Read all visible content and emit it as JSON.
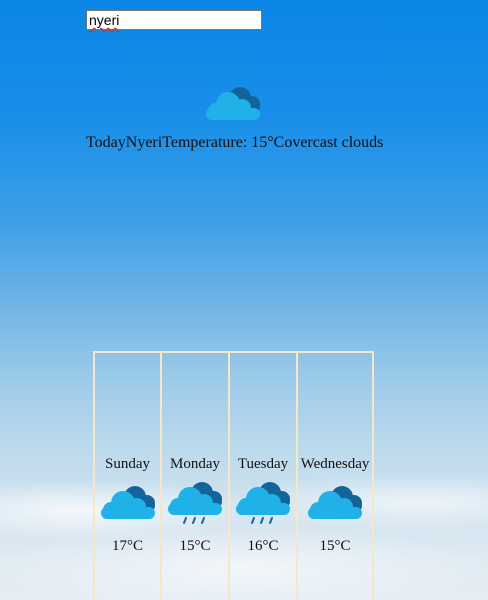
{
  "search": {
    "value": "nyeri"
  },
  "today": {
    "label": "Today",
    "city": "Nyeri",
    "temperature_text": "Temperature: 15°C",
    "description": "overcast clouds",
    "icon": "cloud-icon"
  },
  "forecast": [
    {
      "day": "Sunday",
      "temp": "17°C",
      "icon": "cloud-icon"
    },
    {
      "day": "Monday",
      "temp": "15°C",
      "icon": "rain-cloud-icon"
    },
    {
      "day": "Tuesday",
      "temp": "16°C",
      "icon": "rain-cloud-icon"
    },
    {
      "day": "Wednesday",
      "temp": "15°C",
      "icon": "cloud-icon"
    }
  ],
  "colors": {
    "cloud_front": "#1fb1e8",
    "cloud_back": "#13649b",
    "rain": "#13649b",
    "card_border": "#f6e7c8"
  }
}
